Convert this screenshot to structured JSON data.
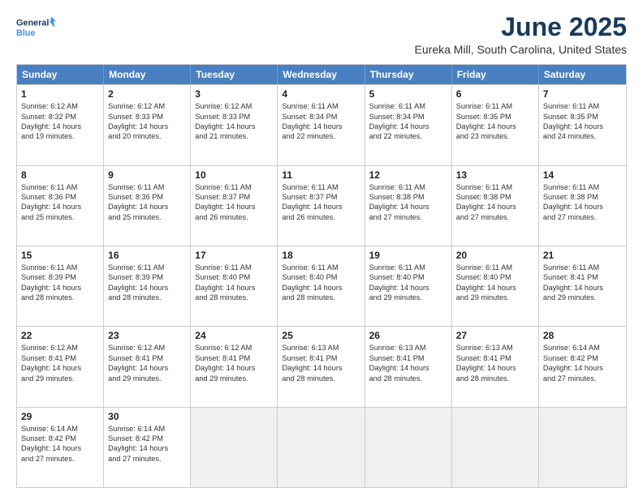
{
  "logo": {
    "line1": "General",
    "line2": "Blue"
  },
  "title": "June 2025",
  "subtitle": "Eureka Mill, South Carolina, United States",
  "weekdays": [
    "Sunday",
    "Monday",
    "Tuesday",
    "Wednesday",
    "Thursday",
    "Friday",
    "Saturday"
  ],
  "rows": [
    [
      {
        "day": "1",
        "lines": [
          "Sunrise: 6:12 AM",
          "Sunset: 8:32 PM",
          "Daylight: 14 hours",
          "and 19 minutes."
        ]
      },
      {
        "day": "2",
        "lines": [
          "Sunrise: 6:12 AM",
          "Sunset: 8:33 PM",
          "Daylight: 14 hours",
          "and 20 minutes."
        ]
      },
      {
        "day": "3",
        "lines": [
          "Sunrise: 6:12 AM",
          "Sunset: 8:33 PM",
          "Daylight: 14 hours",
          "and 21 minutes."
        ]
      },
      {
        "day": "4",
        "lines": [
          "Sunrise: 6:11 AM",
          "Sunset: 8:34 PM",
          "Daylight: 14 hours",
          "and 22 minutes."
        ]
      },
      {
        "day": "5",
        "lines": [
          "Sunrise: 6:11 AM",
          "Sunset: 8:34 PM",
          "Daylight: 14 hours",
          "and 22 minutes."
        ]
      },
      {
        "day": "6",
        "lines": [
          "Sunrise: 6:11 AM",
          "Sunset: 8:35 PM",
          "Daylight: 14 hours",
          "and 23 minutes."
        ]
      },
      {
        "day": "7",
        "lines": [
          "Sunrise: 6:11 AM",
          "Sunset: 8:35 PM",
          "Daylight: 14 hours",
          "and 24 minutes."
        ]
      }
    ],
    [
      {
        "day": "8",
        "lines": [
          "Sunrise: 6:11 AM",
          "Sunset: 8:36 PM",
          "Daylight: 14 hours",
          "and 25 minutes."
        ]
      },
      {
        "day": "9",
        "lines": [
          "Sunrise: 6:11 AM",
          "Sunset: 8:36 PM",
          "Daylight: 14 hours",
          "and 25 minutes."
        ]
      },
      {
        "day": "10",
        "lines": [
          "Sunrise: 6:11 AM",
          "Sunset: 8:37 PM",
          "Daylight: 14 hours",
          "and 26 minutes."
        ]
      },
      {
        "day": "11",
        "lines": [
          "Sunrise: 6:11 AM",
          "Sunset: 8:37 PM",
          "Daylight: 14 hours",
          "and 26 minutes."
        ]
      },
      {
        "day": "12",
        "lines": [
          "Sunrise: 6:11 AM",
          "Sunset: 8:38 PM",
          "Daylight: 14 hours",
          "and 27 minutes."
        ]
      },
      {
        "day": "13",
        "lines": [
          "Sunrise: 6:11 AM",
          "Sunset: 8:38 PM",
          "Daylight: 14 hours",
          "and 27 minutes."
        ]
      },
      {
        "day": "14",
        "lines": [
          "Sunrise: 6:11 AM",
          "Sunset: 8:38 PM",
          "Daylight: 14 hours",
          "and 27 minutes."
        ]
      }
    ],
    [
      {
        "day": "15",
        "lines": [
          "Sunrise: 6:11 AM",
          "Sunset: 8:39 PM",
          "Daylight: 14 hours",
          "and 28 minutes."
        ]
      },
      {
        "day": "16",
        "lines": [
          "Sunrise: 6:11 AM",
          "Sunset: 8:39 PM",
          "Daylight: 14 hours",
          "and 28 minutes."
        ]
      },
      {
        "day": "17",
        "lines": [
          "Sunrise: 6:11 AM",
          "Sunset: 8:40 PM",
          "Daylight: 14 hours",
          "and 28 minutes."
        ]
      },
      {
        "day": "18",
        "lines": [
          "Sunrise: 6:11 AM",
          "Sunset: 8:40 PM",
          "Daylight: 14 hours",
          "and 28 minutes."
        ]
      },
      {
        "day": "19",
        "lines": [
          "Sunrise: 6:11 AM",
          "Sunset: 8:40 PM",
          "Daylight: 14 hours",
          "and 29 minutes."
        ]
      },
      {
        "day": "20",
        "lines": [
          "Sunrise: 6:11 AM",
          "Sunset: 8:40 PM",
          "Daylight: 14 hours",
          "and 29 minutes."
        ]
      },
      {
        "day": "21",
        "lines": [
          "Sunrise: 6:11 AM",
          "Sunset: 8:41 PM",
          "Daylight: 14 hours",
          "and 29 minutes."
        ]
      }
    ],
    [
      {
        "day": "22",
        "lines": [
          "Sunrise: 6:12 AM",
          "Sunset: 8:41 PM",
          "Daylight: 14 hours",
          "and 29 minutes."
        ]
      },
      {
        "day": "23",
        "lines": [
          "Sunrise: 6:12 AM",
          "Sunset: 8:41 PM",
          "Daylight: 14 hours",
          "and 29 minutes."
        ]
      },
      {
        "day": "24",
        "lines": [
          "Sunrise: 6:12 AM",
          "Sunset: 8:41 PM",
          "Daylight: 14 hours",
          "and 29 minutes."
        ]
      },
      {
        "day": "25",
        "lines": [
          "Sunrise: 6:13 AM",
          "Sunset: 8:41 PM",
          "Daylight: 14 hours",
          "and 28 minutes."
        ]
      },
      {
        "day": "26",
        "lines": [
          "Sunrise: 6:13 AM",
          "Sunset: 8:41 PM",
          "Daylight: 14 hours",
          "and 28 minutes."
        ]
      },
      {
        "day": "27",
        "lines": [
          "Sunrise: 6:13 AM",
          "Sunset: 8:41 PM",
          "Daylight: 14 hours",
          "and 28 minutes."
        ]
      },
      {
        "day": "28",
        "lines": [
          "Sunrise: 6:14 AM",
          "Sunset: 8:42 PM",
          "Daylight: 14 hours",
          "and 27 minutes."
        ]
      }
    ],
    [
      {
        "day": "29",
        "lines": [
          "Sunrise: 6:14 AM",
          "Sunset: 8:42 PM",
          "Daylight: 14 hours",
          "and 27 minutes."
        ]
      },
      {
        "day": "30",
        "lines": [
          "Sunrise: 6:14 AM",
          "Sunset: 8:42 PM",
          "Daylight: 14 hours",
          "and 27 minutes."
        ]
      },
      {
        "day": "",
        "lines": []
      },
      {
        "day": "",
        "lines": []
      },
      {
        "day": "",
        "lines": []
      },
      {
        "day": "",
        "lines": []
      },
      {
        "day": "",
        "lines": []
      }
    ]
  ]
}
